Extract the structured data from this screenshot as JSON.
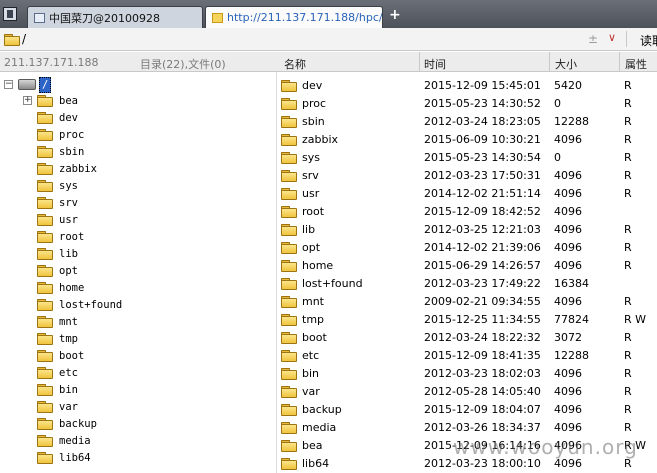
{
  "tabs": [
    {
      "label": "中国菜刀@20100928"
    },
    {
      "label": "http://211.137.171.188/hpc/..."
    }
  ],
  "new_tab_label": "+",
  "address": {
    "path": "/",
    "plus": "±",
    "chevron": "∨",
    "read_label": "读取"
  },
  "header": {
    "host": "211.137.171.188",
    "summary": "目录(22),文件(0)",
    "columns": {
      "name": "名称",
      "time": "时间",
      "size": "大小",
      "attr": "属性"
    }
  },
  "tree": {
    "root_label": "/",
    "nodes": [
      "bea",
      "dev",
      "proc",
      "sbin",
      "zabbix",
      "sys",
      "srv",
      "usr",
      "root",
      "lib",
      "opt",
      "home",
      "lost+found",
      "mnt",
      "tmp",
      "boot",
      "etc",
      "bin",
      "var",
      "backup",
      "media",
      "lib64"
    ]
  },
  "files": [
    {
      "name": "dev",
      "time": "2015-12-09 15:45:01",
      "size": "5420",
      "attr": "R"
    },
    {
      "name": "proc",
      "time": "2015-05-23 14:30:52",
      "size": "0",
      "attr": "R"
    },
    {
      "name": "sbin",
      "time": "2012-03-24 18:23:05",
      "size": "12288",
      "attr": "R"
    },
    {
      "name": "zabbix",
      "time": "2015-06-09 10:30:21",
      "size": "4096",
      "attr": "R"
    },
    {
      "name": "sys",
      "time": "2015-05-23 14:30:54",
      "size": "0",
      "attr": "R"
    },
    {
      "name": "srv",
      "time": "2012-03-23 17:50:31",
      "size": "4096",
      "attr": "R"
    },
    {
      "name": "usr",
      "time": "2014-12-02 21:51:14",
      "size": "4096",
      "attr": "R"
    },
    {
      "name": "root",
      "time": "2015-12-09 18:42:52",
      "size": "4096",
      "attr": ""
    },
    {
      "name": "lib",
      "time": "2012-03-25 12:21:03",
      "size": "4096",
      "attr": "R"
    },
    {
      "name": "opt",
      "time": "2014-12-02 21:39:06",
      "size": "4096",
      "attr": "R"
    },
    {
      "name": "home",
      "time": "2015-06-29 14:26:57",
      "size": "4096",
      "attr": "R"
    },
    {
      "name": "lost+found",
      "time": "2012-03-23 17:49:22",
      "size": "16384",
      "attr": ""
    },
    {
      "name": "mnt",
      "time": "2009-02-21 09:34:55",
      "size": "4096",
      "attr": "R"
    },
    {
      "name": "tmp",
      "time": "2015-12-25 11:34:55",
      "size": "77824",
      "attr": "R W"
    },
    {
      "name": "boot",
      "time": "2012-03-24 18:22:32",
      "size": "3072",
      "attr": "R"
    },
    {
      "name": "etc",
      "time": "2015-12-09 18:41:35",
      "size": "12288",
      "attr": "R"
    },
    {
      "name": "bin",
      "time": "2012-03-23 18:02:03",
      "size": "4096",
      "attr": "R"
    },
    {
      "name": "var",
      "time": "2012-05-28 14:05:40",
      "size": "4096",
      "attr": "R"
    },
    {
      "name": "backup",
      "time": "2015-12-09 18:04:07",
      "size": "4096",
      "attr": "R"
    },
    {
      "name": "media",
      "time": "2012-03-26 18:34:37",
      "size": "4096",
      "attr": "R"
    },
    {
      "name": "bea",
      "time": "2015-12-09 16:14:16",
      "size": "4096",
      "attr": "R W"
    },
    {
      "name": "lib64",
      "time": "2012-03-23 18:00:10",
      "size": "4096",
      "attr": "R"
    }
  ],
  "watermark": "www.wooyun.org"
}
